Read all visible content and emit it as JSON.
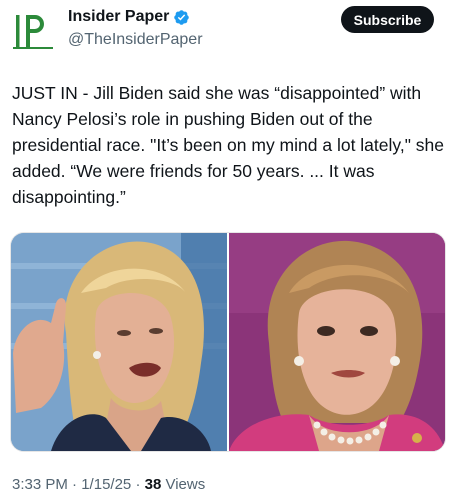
{
  "header": {
    "display_name": "Insider Paper",
    "handle": "@TheInsiderPaper",
    "subscribe_label": "Subscribe",
    "verified_color": "#1d9bf0",
    "avatar_icon": "insider-paper-logo"
  },
  "tweet": {
    "text": "JUST IN - Jill Biden said she was “disappointed” with Nancy Pelosi’s role in pushing Biden out of the presidential race. \"It’s been on my mind a lot lately,\" she added. “We were friends for 50 years. ... It was disappointing.”"
  },
  "media": {
    "left_photo_bg": "#7fa8cf",
    "right_photo_bg": "#8a3579"
  },
  "meta": {
    "time": "3:33 PM",
    "separator": "·",
    "date": "1/15/25",
    "views_count": "38",
    "views_label": "Views"
  }
}
